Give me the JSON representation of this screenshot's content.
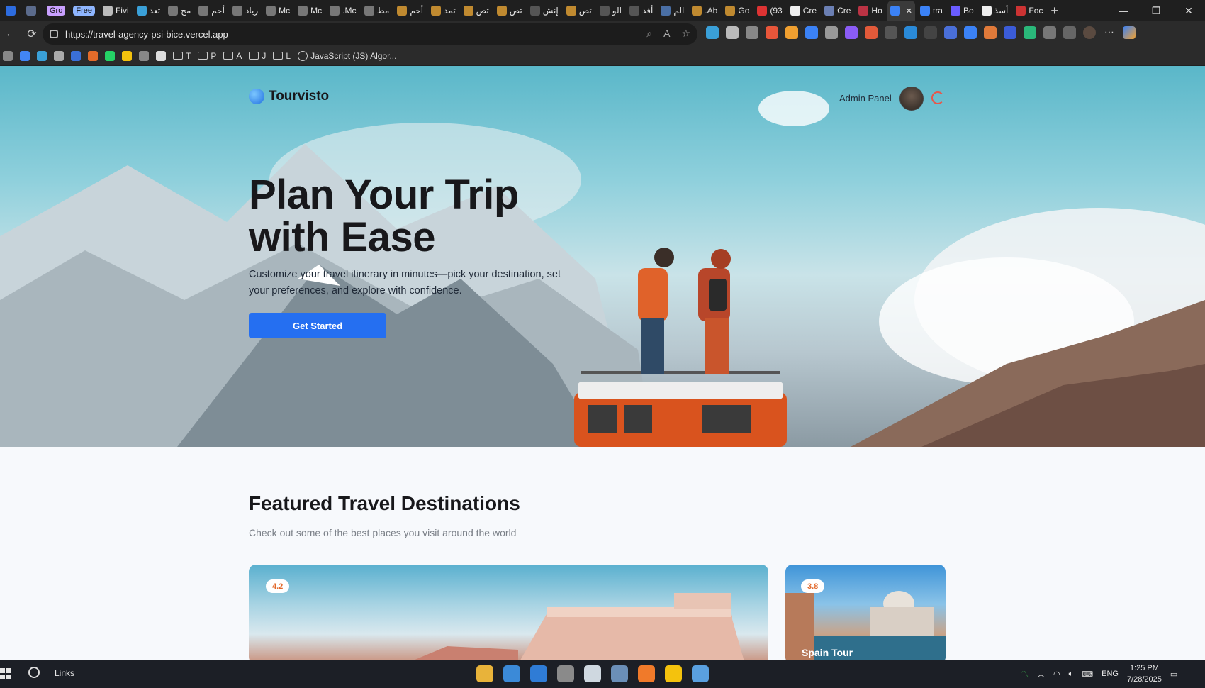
{
  "browser": {
    "tabs": [
      {
        "label": "",
        "color": "#2d6cdf"
      },
      {
        "label": "",
        "color": "#5b6b8c"
      },
      {
        "label": "Gro",
        "color": "#c9a0ff",
        "pill": true
      },
      {
        "label": "Free",
        "color": "#8fb6ff",
        "pill": true
      },
      {
        "label": "Fivi",
        "color": "#bbbbbb"
      },
      {
        "label": "تعد",
        "color": "#3aa0d8"
      },
      {
        "label": "مح",
        "color": "#777777"
      },
      {
        "label": "أحم",
        "color": "#777777"
      },
      {
        "label": "زياد",
        "color": "#777777"
      },
      {
        "label": "Mc",
        "color": "#777777"
      },
      {
        "label": "Mc",
        "color": "#777777"
      },
      {
        "label": ".Mc",
        "color": "#777777"
      },
      {
        "label": "مط",
        "color": "#777777"
      },
      {
        "label": "أحم",
        "color": "#c08a30"
      },
      {
        "label": "تمد",
        "color": "#c08a30"
      },
      {
        "label": "تص",
        "color": "#c08a30"
      },
      {
        "label": "تص",
        "color": "#c08a30"
      },
      {
        "label": "إنش",
        "color": "#555555"
      },
      {
        "label": "تص",
        "color": "#c08a30"
      },
      {
        "label": "الو",
        "color": "#555555"
      },
      {
        "label": "أفد",
        "color": "#555555"
      },
      {
        "label": "الم",
        "color": "#4a6fa5"
      },
      {
        "label": ".Ab",
        "color": "#c08a30"
      },
      {
        "label": "Go",
        "color": "#c08a30"
      },
      {
        "label": "(93",
        "color": "#d33"
      },
      {
        "label": "Cre",
        "color": "#eeeeee"
      },
      {
        "label": "Cre",
        "color": "#6b7fb3"
      },
      {
        "label": "Ho",
        "color": "#b34"
      },
      {
        "label": "",
        "color": "#3b82f6",
        "active": true
      },
      {
        "label": "tra",
        "color": "#3b82f6"
      },
      {
        "label": "Bo",
        "color": "#6a5cff"
      },
      {
        "label": "أسذ",
        "color": "#eeeeee"
      },
      {
        "label": "Foc",
        "color": "#c33"
      }
    ],
    "new_tab_label": "+",
    "url": "https://travel-agency-psi-bice.vercel.app",
    "bookmarks": [
      {
        "label": "",
        "type": "icon",
        "color": "#4285f4"
      },
      {
        "label": "",
        "type": "icon",
        "color": "#3aa0d8"
      },
      {
        "label": "",
        "type": "icon",
        "color": "#aaaaaa"
      },
      {
        "label": "",
        "type": "icon",
        "color": "#3a6fd8"
      },
      {
        "label": "",
        "type": "icon",
        "color": "#e26b2a"
      },
      {
        "label": "",
        "type": "icon",
        "color": "#25d366"
      },
      {
        "label": "",
        "type": "icon",
        "color": "#f4c20d"
      },
      {
        "label": "",
        "type": "icon",
        "color": "#888888"
      },
      {
        "label": "",
        "type": "icon",
        "color": "#dddddd"
      },
      {
        "label": "T",
        "type": "folder"
      },
      {
        "label": "P",
        "type": "folder"
      },
      {
        "label": "A",
        "type": "folder"
      },
      {
        "label": "J",
        "type": "folder"
      },
      {
        "label": "L",
        "type": "folder"
      },
      {
        "label": "JavaScript (JS) Algor...",
        "type": "globe"
      }
    ]
  },
  "site": {
    "brand": "Tourvisto",
    "admin_link": "Admin Panel",
    "hero": {
      "headline_line1": "Plan Your Trip",
      "headline_line2": "with Ease",
      "subtext": "Customize your travel itinerary in minutes—pick your destination, set your preferences, and explore with confidence.",
      "cta": "Get Started"
    },
    "featured": {
      "title": "Featured Travel Destinations",
      "subtitle": "Check out some of the best places you visit around the world",
      "cards": [
        {
          "rating": "4.2",
          "title": ""
        },
        {
          "rating": "3.8",
          "title": "Spain Tour"
        }
      ]
    }
  },
  "taskbar": {
    "search_label": "Links",
    "language": "ENG",
    "time": "1:25 PM",
    "date": "7/28/2025",
    "apps": [
      "#e8b33a",
      "#3b8ad8",
      "#2f7cd6",
      "#8a8a8a",
      "#cfd8e0",
      "#6b8fb8",
      "#f07a2a",
      "#f4c20d",
      "#5aa0e0"
    ]
  },
  "colors": {
    "accent": "#256ff1",
    "rating_text": "#e2682a"
  }
}
